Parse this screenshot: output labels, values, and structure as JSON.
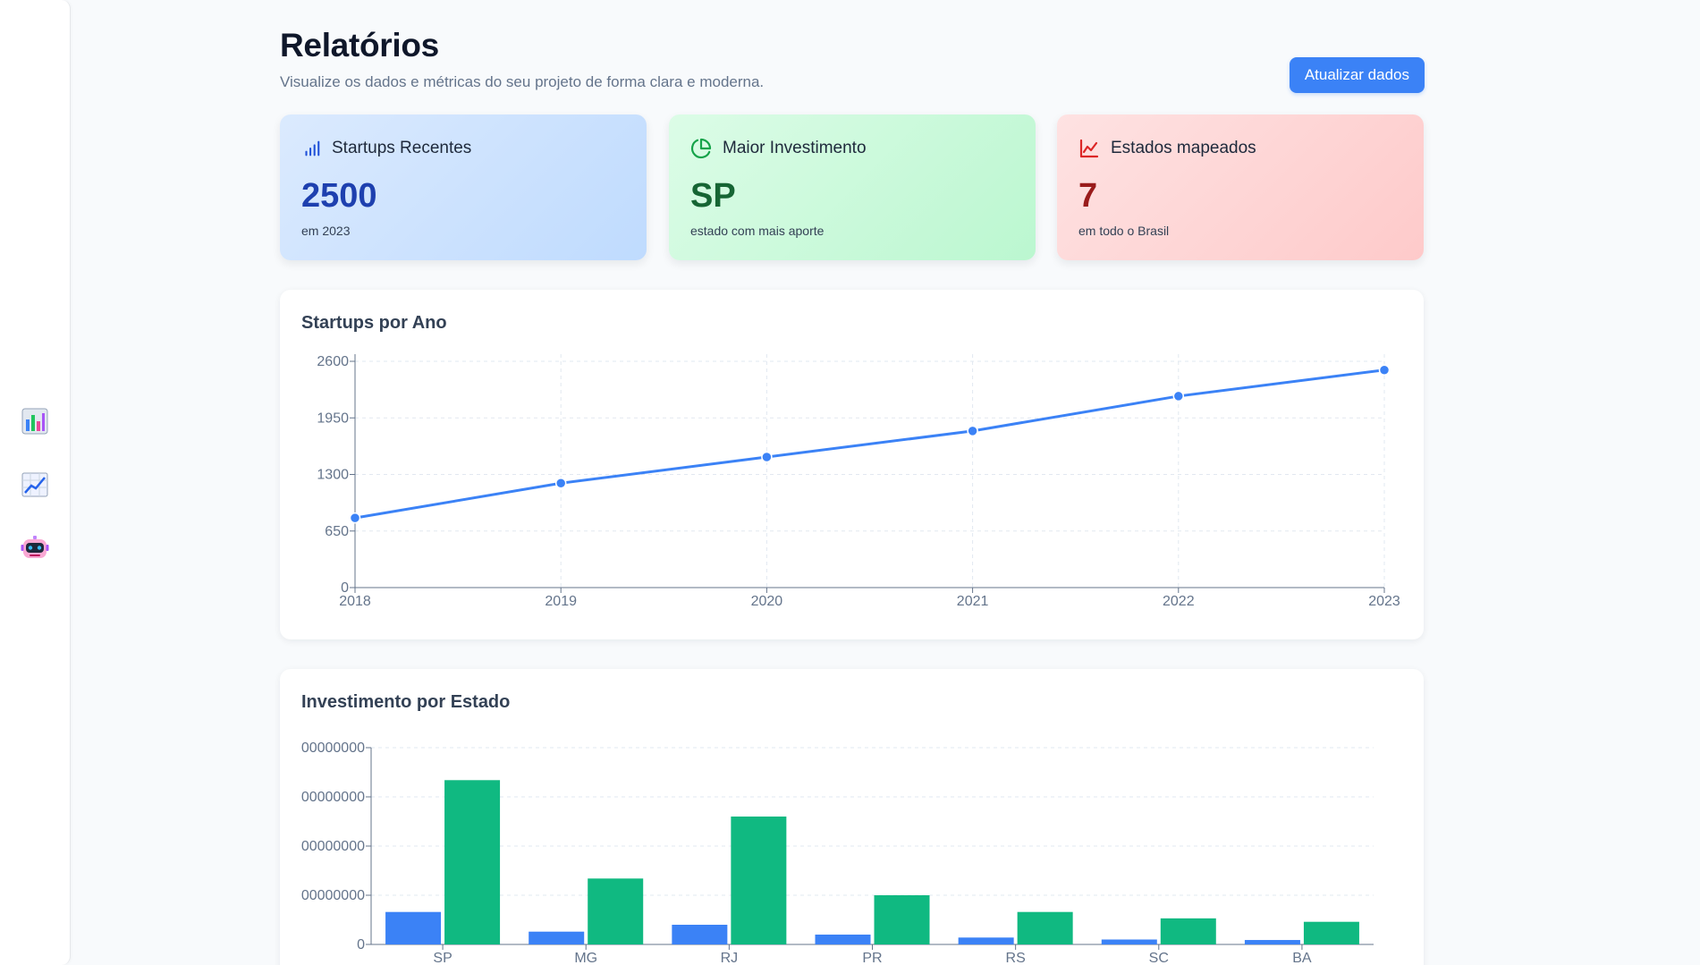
{
  "sidebar": {
    "items": [
      {
        "icon": "bar-chart-icon"
      },
      {
        "icon": "trend-chart-icon"
      },
      {
        "icon": "robot-icon"
      }
    ]
  },
  "header": {
    "title": "Relatórios",
    "subtitle": "Visualize os dados e métricas do seu projeto de forma clara e moderna.",
    "refresh_label": "Atualizar dados"
  },
  "stats": [
    {
      "label": "Startups Recentes",
      "value": "2500",
      "caption": "em 2023",
      "icon": "bar-chart-icon",
      "color": "#1d4ed8"
    },
    {
      "label": "Maior Investimento",
      "value": "SP",
      "caption": "estado com mais aporte",
      "icon": "pie-chart-icon",
      "color": "#16a34a"
    },
    {
      "label": "Estados mapeados",
      "value": "7",
      "caption": "em todo o Brasil",
      "icon": "line-chart-icon",
      "color": "#dc2626"
    }
  ],
  "charts": {
    "line_title": "Startups por Ano",
    "bar_title": "Investimento por Estado"
  },
  "chart_data": [
    {
      "type": "line",
      "title": "Startups por Ano",
      "x": [
        "2018",
        "2019",
        "2020",
        "2021",
        "2022",
        "2023"
      ],
      "series": [
        {
          "values": [
            800,
            1200,
            1500,
            1800,
            2200,
            2500
          ],
          "color": "#3b82f6"
        }
      ],
      "yticks": [
        0,
        650,
        1300,
        1950,
        2600
      ],
      "ylim": [
        0,
        2600
      ],
      "grid": true
    },
    {
      "type": "bar",
      "title": "Investimento por Estado",
      "categories": [
        "SP",
        "MG",
        "RJ",
        "PR",
        "RS",
        "SC",
        "BA"
      ],
      "series": [
        {
          "values": [
            6600000,
            2600000,
            4000000,
            2000000,
            1400000,
            1000000,
            900000
          ],
          "color": "#3b82f6"
        },
        {
          "values": [
            33400000,
            13400000,
            26000000,
            10000000,
            6600000,
            5300000,
            4600000
          ],
          "color": "#10b981"
        }
      ],
      "ytick_labels": [
        "0",
        "00000000",
        "00000000",
        "00000000",
        "00000000"
      ],
      "yticks": [
        0,
        10000000,
        20000000,
        30000000,
        40000000
      ],
      "ylim": [
        0,
        40000000
      ],
      "grid": true
    }
  ]
}
